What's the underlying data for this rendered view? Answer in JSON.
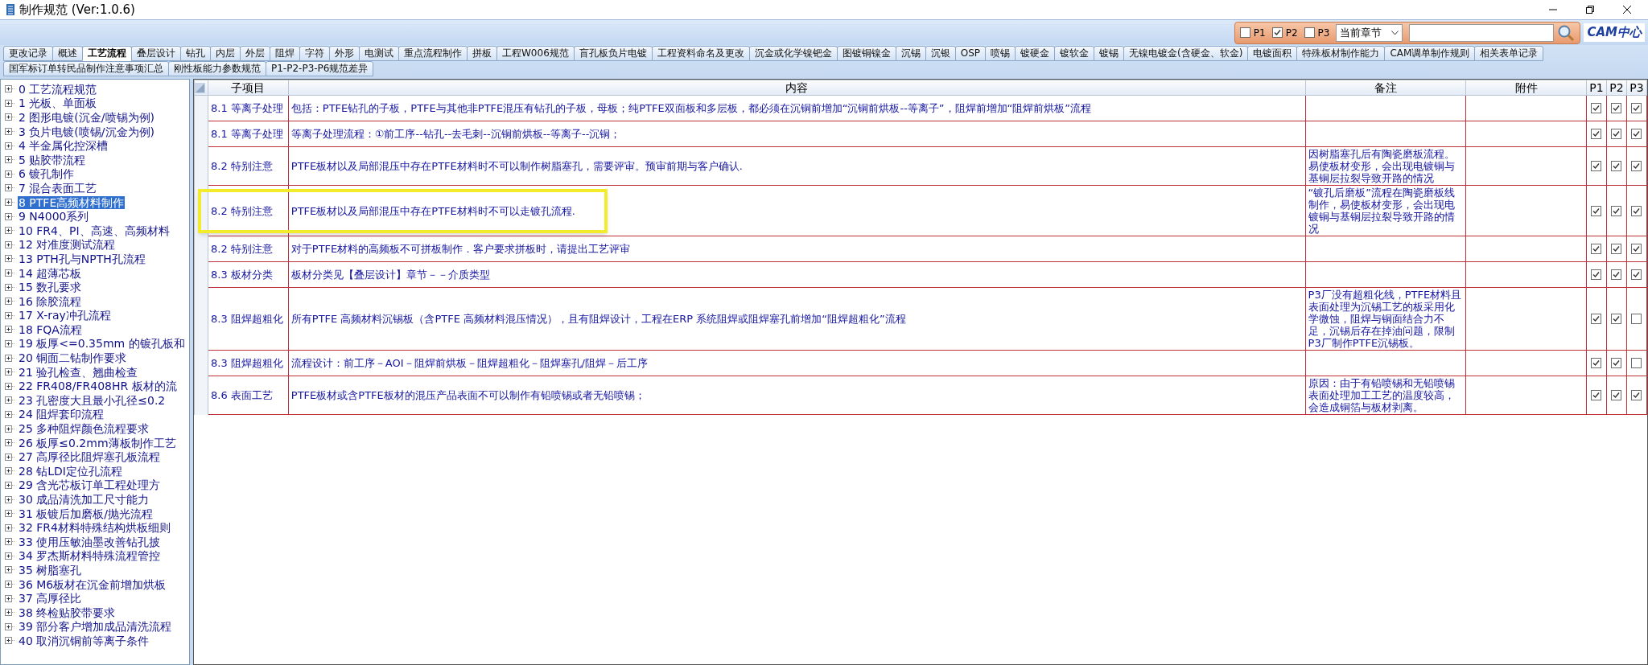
{
  "window": {
    "title": "制作规范 (Ver:1.0.6)"
  },
  "toolbar": {
    "filters": [
      {
        "label": "P1",
        "checked": false
      },
      {
        "label": "P2",
        "checked": true
      },
      {
        "label": "P3",
        "checked": false
      }
    ],
    "scope_select": {
      "value": "当前章节"
    },
    "logo_text": "CAM中心"
  },
  "tabs_row_1": [
    {
      "label": "更改记录",
      "selected": false
    },
    {
      "label": "概述",
      "selected": false
    },
    {
      "label": "工艺流程",
      "selected": true
    },
    {
      "label": "叠层设计",
      "selected": false
    },
    {
      "label": "钻孔",
      "selected": false
    },
    {
      "label": "内层",
      "selected": false
    },
    {
      "label": "外层",
      "selected": false
    },
    {
      "label": "阻焊",
      "selected": false
    },
    {
      "label": "字符",
      "selected": false
    },
    {
      "label": "外形",
      "selected": false
    },
    {
      "label": "电测试",
      "selected": false
    },
    {
      "label": "重点流程制作",
      "selected": false
    },
    {
      "label": "拼板",
      "selected": false
    },
    {
      "label": "工程W006规范",
      "selected": false
    },
    {
      "label": "盲孔板负片电镀",
      "selected": false
    },
    {
      "label": "工程资料命名及更改",
      "selected": false
    },
    {
      "label": "沉金或化学镍钯金",
      "selected": false
    },
    {
      "label": "图镀铜镍金",
      "selected": false
    },
    {
      "label": "沉锡",
      "selected": false
    },
    {
      "label": "沉银",
      "selected": false
    },
    {
      "label": "OSP",
      "selected": false
    },
    {
      "label": "喷锡",
      "selected": false
    },
    {
      "label": "镀硬金",
      "selected": false
    },
    {
      "label": "镀软金",
      "selected": false
    },
    {
      "label": "镀锡",
      "selected": false
    },
    {
      "label": "无镍电镀金(含硬金、软金)",
      "selected": false
    },
    {
      "label": "电镀面积",
      "selected": false
    },
    {
      "label": "特殊板材制作能力",
      "selected": false
    },
    {
      "label": "CAM调单制作规则",
      "selected": false
    },
    {
      "label": "相关表单记录",
      "selected": false
    }
  ],
  "tabs_row_2": [
    {
      "label": "国军标订单转民品制作注意事项汇总",
      "selected": false
    },
    {
      "label": "刚性板能力参数规范",
      "selected": false
    },
    {
      "label": "P1-P2-P3-P6规范差异",
      "selected": false
    }
  ],
  "tree": {
    "items": [
      {
        "label": "0 工艺流程规范",
        "selected": false
      },
      {
        "label": "1 光板、单面板",
        "selected": false
      },
      {
        "label": "2 图形电镀(沉金/喷锡为例)",
        "selected": false
      },
      {
        "label": "3 负片电镀(喷锡/沉金为例)",
        "selected": false
      },
      {
        "label": "4 半金属化控深槽",
        "selected": false
      },
      {
        "label": "5 贴胶带流程",
        "selected": false
      },
      {
        "label": "6 镀孔制作",
        "selected": false
      },
      {
        "label": "7 混合表面工艺",
        "selected": false
      },
      {
        "label": "8 PTFE高频材料制作",
        "selected": true
      },
      {
        "label": "9 N4000系列",
        "selected": false
      },
      {
        "label": "10 FR4、PI、高速、高频材料",
        "selected": false
      },
      {
        "label": "12 对准度测试流程",
        "selected": false
      },
      {
        "label": "13 PTH孔与NPTH孔流程",
        "selected": false
      },
      {
        "label": "14 超薄芯板",
        "selected": false
      },
      {
        "label": "15 数孔要求",
        "selected": false
      },
      {
        "label": "16 除胶流程",
        "selected": false
      },
      {
        "label": "17 X-ray冲孔流程",
        "selected": false
      },
      {
        "label": "18 FQA流程",
        "selected": false
      },
      {
        "label": "19 板厚<=0.35mm 的镀孔板和",
        "selected": false
      },
      {
        "label": "20 铜面二钻制作要求",
        "selected": false
      },
      {
        "label": "21 验孔检查、翘曲检查",
        "selected": false
      },
      {
        "label": "22 FR408/FR408HR 板材的流",
        "selected": false
      },
      {
        "label": "23 孔密度大且最小孔径≤0.2",
        "selected": false
      },
      {
        "label": "24 阻焊套印流程",
        "selected": false
      },
      {
        "label": "25 多种阻焊颜色流程要求",
        "selected": false
      },
      {
        "label": "26 板厚≤0.2mm薄板制作工艺",
        "selected": false
      },
      {
        "label": "27 高厚径比阻焊塞孔板流程",
        "selected": false
      },
      {
        "label": "28 钻LDI定位孔流程",
        "selected": false
      },
      {
        "label": "29 含光芯板订单工程处理方",
        "selected": false
      },
      {
        "label": "30 成品清洗加工尺寸能力",
        "selected": false
      },
      {
        "label": "31 板镀后加磨板/抛光流程",
        "selected": false
      },
      {
        "label": "32 FR4材料特殊结构烘板细则",
        "selected": false
      },
      {
        "label": "33 使用压敏油墨改善钻孔披",
        "selected": false
      },
      {
        "label": "34 罗杰斯材料特殊流程管控",
        "selected": false
      },
      {
        "label": "35 树脂塞孔",
        "selected": false
      },
      {
        "label": "36 M6板材在沉金前增加烘板",
        "selected": false
      },
      {
        "label": "37 高厚径比",
        "selected": false
      },
      {
        "label": "38 终检贴胶带要求",
        "selected": false
      },
      {
        "label": "39 部分客户增加成品清洗流程",
        "selected": false
      },
      {
        "label": "40 取消沉铜前等离子条件",
        "selected": false
      }
    ]
  },
  "table": {
    "columns": [
      "子项目",
      "内容",
      "备注",
      "附件",
      "P1",
      "P2",
      "P3"
    ],
    "rows": [
      {
        "sub_item": "8.1 等离子处理",
        "content": "包括：PTFE钻孔的子板，PTFE与其他非PTFE混压有钻孔的子板，母板；纯PTFE双面板和多层板，都必须在沉铜前增加“沉铜前烘板--等离子”，阻焊前增加“阻焊前烘板”流程",
        "highlighted": false,
        "p1": true,
        "p2": true,
        "p3": true
      },
      {
        "sub_item": "8.1 等离子处理",
        "content": "等离子处理流程：①前工序--钻孔--去毛刺--沉铜前烘板--等离子--沉铜；",
        "highlighted": false,
        "p1": true,
        "p2": true,
        "p3": true
      },
      {
        "sub_item": "8.2 特别注意",
        "content": "PTFE板材以及局部混压中存在PTFE材料时不可以制作树脂塞孔，需要评审。预审前期与客户确认.",
        "remark": "因树脂塞孔后有陶瓷磨板流程。易使板材变形，会出现电镀铜与基铜层拉裂导致开路的情况",
        "highlighted": false,
        "p1": true,
        "p2": true,
        "p3": true
      },
      {
        "sub_item": "8.2 特别注意",
        "content": "PTFE板材以及局部混压中存在PTFE材料时不可以走镀孔流程.",
        "remark": "“镀孔后磨板”流程在陶瓷磨板线制作，易使板材变形，会出现电镀铜与基铜层拉裂导致开路的情况",
        "highlighted": true,
        "p1": true,
        "p2": true,
        "p3": true
      },
      {
        "sub_item": "8.2 特别注意",
        "content": "对于PTFE材料的高频板不可拼板制作．客户要求拼板时，请提出工艺评审",
        "highlighted": false,
        "p1": true,
        "p2": true,
        "p3": true
      },
      {
        "sub_item": "8.3 板材分类",
        "content": "板材分类见【叠层设计】章节－－介质类型",
        "highlighted": false,
        "p1": true,
        "p2": true,
        "p3": true
      },
      {
        "sub_item": "8.3 阻焊超粗化",
        "content": "所有PTFE 高频材料沉锡板（含PTFE 高频材料混压情况），且有阻焊设计，工程在ERP 系统阻焊或阻焊塞孔前增加“阻焊超粗化”流程",
        "remark": "P3厂没有超粗化线，PTFE材料且表面处理为沉锡工艺的板采用化学微蚀，阻焊与铜面结合力不足，沉锡后存在掉油问题，限制P3厂制作PTFE沉锡板。",
        "highlighted": false,
        "p1": true,
        "p2": true,
        "p3": false
      },
      {
        "sub_item": "8.3 阻焊超粗化",
        "content": "流程设计：前工序－AOI－阻焊前烘板－阻焊超粗化－阻焊塞孔/阻焊－后工序",
        "highlighted": false,
        "p1": true,
        "p2": true,
        "p3": false
      },
      {
        "sub_item": "8.6 表面工艺",
        "content": "PTFE板材或含PTFE板材的混压产品表面不可以制作有铅喷锡或者无铅喷锡；",
        "remark": "原因：由于有铅喷锡和无铅喷锡表面处理加工工艺的温度较高，会造成铜箔与板材剥离。",
        "highlighted": false,
        "p1": true,
        "p2": true,
        "p3": true
      }
    ]
  }
}
